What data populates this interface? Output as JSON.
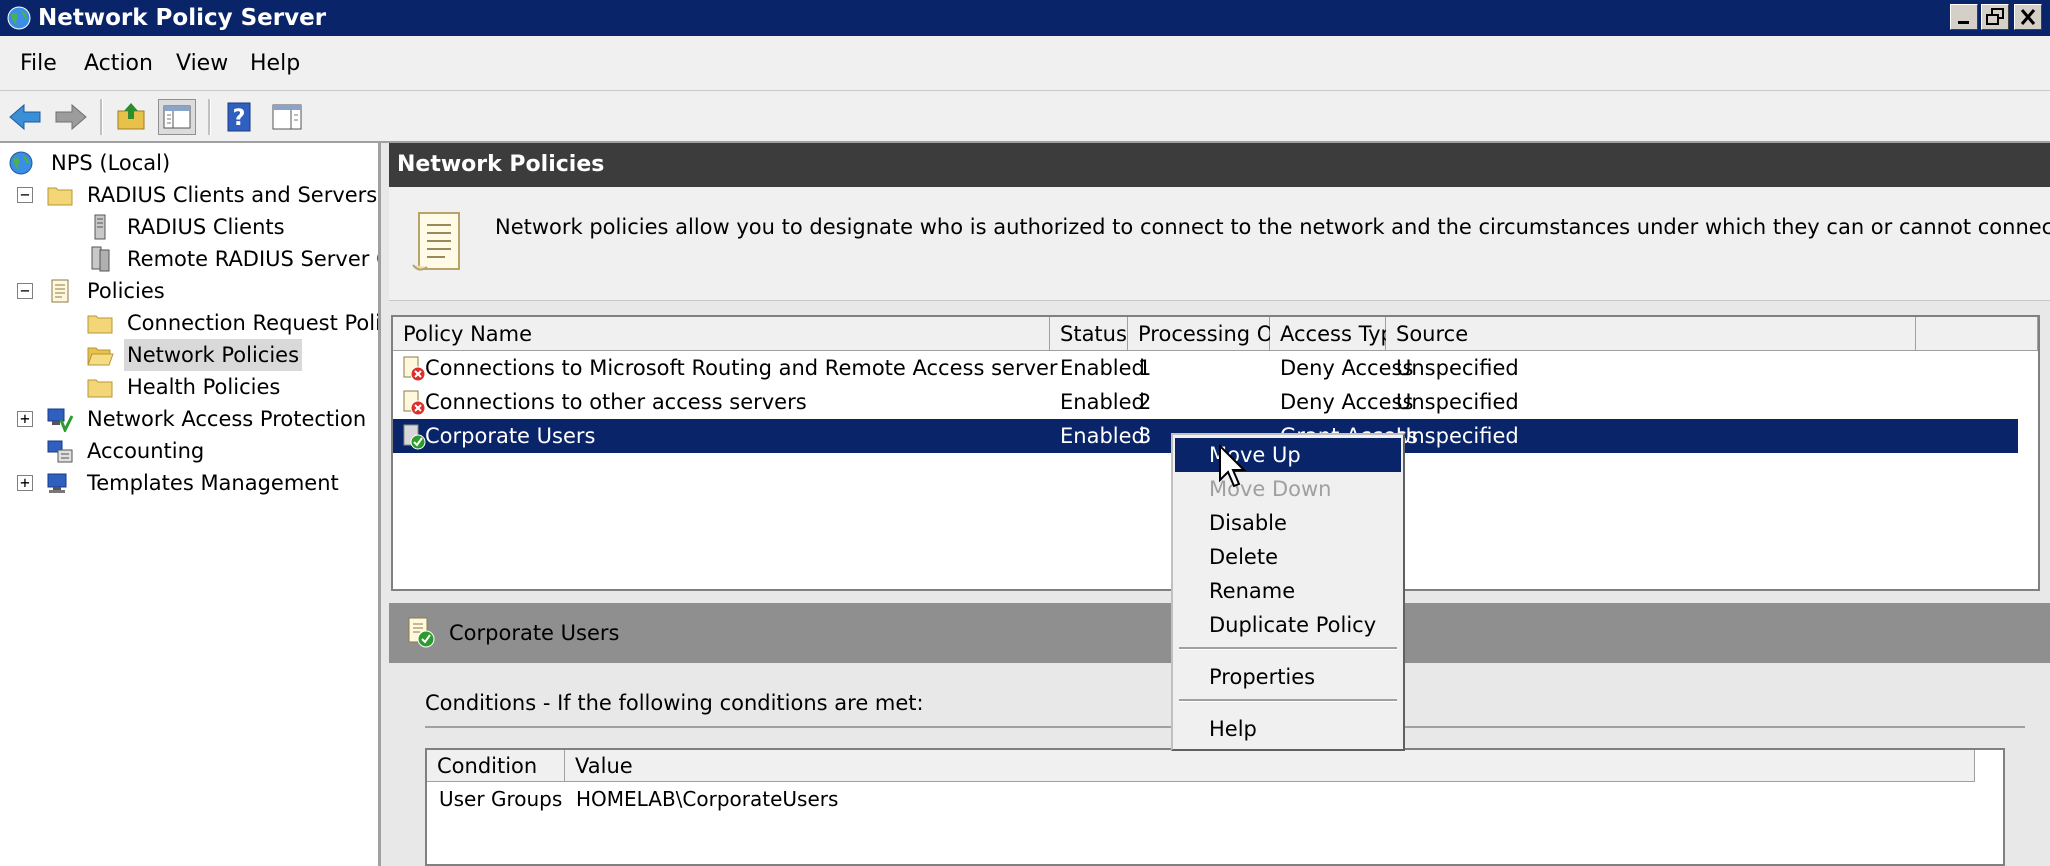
{
  "window": {
    "title": "Network Policy Server"
  },
  "menubar": [
    "File",
    "Action",
    "View",
    "Help"
  ],
  "tree": {
    "root": "NPS (Local)",
    "radius_group": "RADIUS Clients and Servers",
    "radius_clients": "RADIUS Clients",
    "remote_radius": "Remote RADIUS Server G",
    "policies": "Policies",
    "connection_request": "Connection Request Polici",
    "network_policies": "Network Policies",
    "health_policies": "Health Policies",
    "nap": "Network Access Protection",
    "accounting": "Accounting",
    "templates": "Templates Management"
  },
  "main": {
    "header": "Network Policies",
    "description": "Network policies allow you to designate who is authorized to connect to the network and the circumstances under which they can or cannot connect."
  },
  "grid": {
    "columns": [
      "Policy Name",
      "Status",
      "Processing Order",
      "Access Type",
      "Source"
    ],
    "rows": [
      {
        "name": "Connections to Microsoft Routing and Remote Access server",
        "status": "Enabled",
        "order": "1",
        "access": "Deny Access",
        "source": "Unspecified",
        "icon": "deny-policy-icon"
      },
      {
        "name": "Connections to other access servers",
        "status": "Enabled",
        "order": "2",
        "access": "Deny Access",
        "source": "Unspecified",
        "icon": "deny-policy-icon"
      },
      {
        "name": "Corporate Users",
        "status": "Enabled",
        "order": "3",
        "access": "Grant Access",
        "source": "Unspecified",
        "icon": "grant-policy-icon"
      }
    ]
  },
  "details": {
    "title": "Corporate Users",
    "conditions_label": "Conditions - If the following conditions are met:",
    "columns": [
      "Condition",
      "Value"
    ],
    "rows": [
      {
        "condition": "User Groups",
        "value": "HOMELAB\\CorporateUsers"
      }
    ]
  },
  "context_menu": {
    "items": [
      {
        "label": "Move Up",
        "state": "highlighted"
      },
      {
        "label": "Move Down",
        "state": "disabled"
      },
      {
        "label": "Disable",
        "state": "normal"
      },
      {
        "label": "Delete",
        "state": "normal"
      },
      {
        "label": "Rename",
        "state": "normal"
      },
      {
        "label": "Duplicate Policy",
        "state": "normal"
      },
      {
        "label": "Properties",
        "state": "normal"
      },
      {
        "label": "Help",
        "state": "normal"
      }
    ]
  },
  "colors": {
    "selection": "#0a246a",
    "titlebar": "#0a246a",
    "header_dark": "#3c3c3c",
    "details_header": "#8f8f8f"
  }
}
